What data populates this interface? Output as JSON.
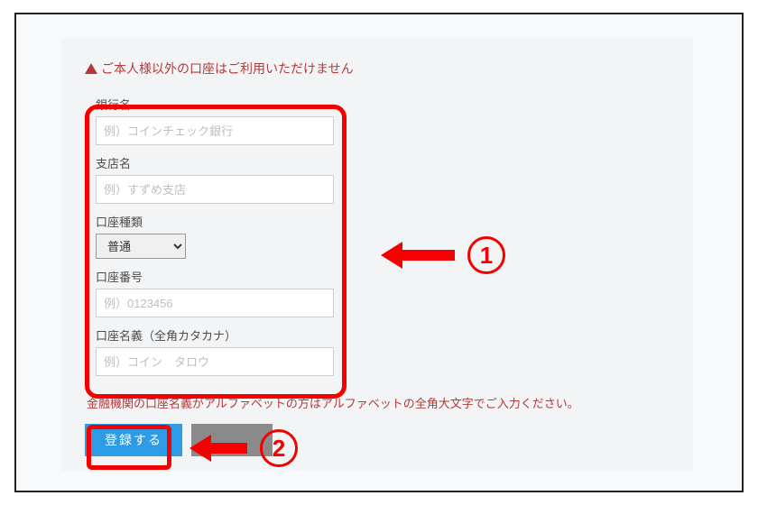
{
  "warning": {
    "text": "ご本人様以外の口座はご利用いただけません"
  },
  "form": {
    "bank_name": {
      "label": "銀行名",
      "placeholder": "例）コインチェック銀行",
      "value": ""
    },
    "branch_name": {
      "label": "支店名",
      "placeholder": "例）すずめ支店",
      "value": ""
    },
    "account_type": {
      "label": "口座種類",
      "selected": "普通"
    },
    "account_number": {
      "label": "口座番号",
      "placeholder": "例）0123456",
      "value": ""
    },
    "account_holder": {
      "label": "口座名義（全角カタカナ）",
      "placeholder": "例）コイン　タロウ",
      "value": ""
    }
  },
  "note": "金融機関の口座名義がアルファベットの方はアルファベットの全角大文字でご入力ください。",
  "buttons": {
    "submit": "登録する",
    "cancel": ""
  },
  "annotations": {
    "one": "1",
    "two": "2"
  }
}
